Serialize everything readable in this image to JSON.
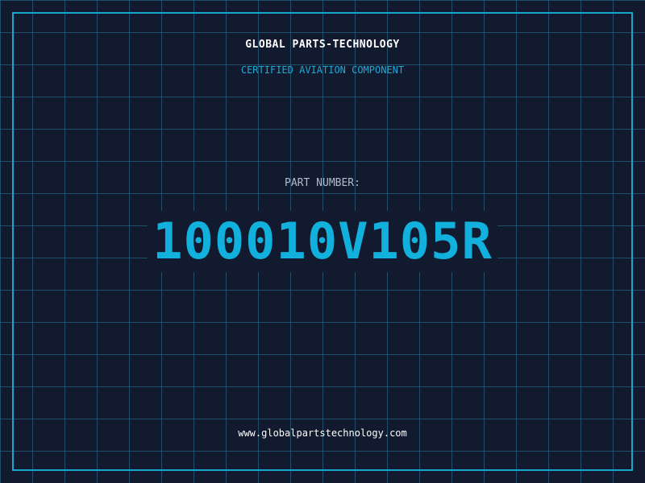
{
  "header": {
    "company_name": "GLOBAL PARTS-TECHNOLOGY",
    "subtitle": "CERTIFIED AVIATION COMPONENT"
  },
  "part": {
    "label": "PART NUMBER:",
    "number": "100010V105R"
  },
  "footer": {
    "website": "www.globalpartstechnology.com"
  },
  "colors": {
    "background": "#111a2e",
    "grid": "#2c7896",
    "accent": "#12b0dc",
    "frame": "#18a6cc",
    "label": "#b3bccb",
    "text": "#ffffff"
  }
}
